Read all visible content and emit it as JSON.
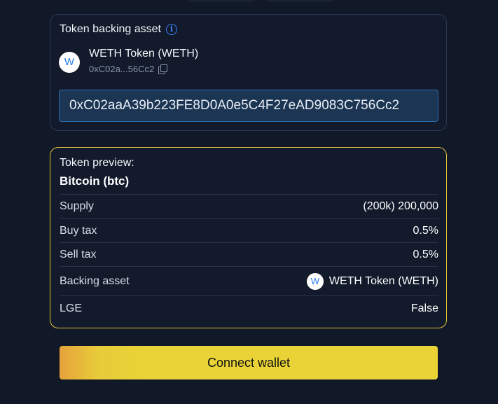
{
  "asset_card": {
    "title": "Token backing asset",
    "info_icon": "info-icon",
    "token": {
      "logo_letter": "W",
      "name": "WETH Token (WETH)",
      "short_address": "0xC02a...56Cc2",
      "copy_icon": "copy-icon"
    },
    "address_input": {
      "value": "0xC02aaA39b223FE8D0A0e5C4F27eAD9083C756Cc2"
    }
  },
  "preview": {
    "label": "Token preview:",
    "name": "Bitcoin (btc)",
    "rows": [
      {
        "label": "Supply",
        "value": "(200k) 200,000"
      },
      {
        "label": "Buy tax",
        "value": "0.5%"
      },
      {
        "label": "Sell tax",
        "value": "0.5%"
      },
      {
        "label": "Backing asset",
        "value": "WETH Token (WETH)",
        "logo_letter": "W"
      },
      {
        "label": "LGE",
        "value": "False"
      }
    ]
  },
  "connect_button": {
    "label": "Connect wallet"
  },
  "colors": {
    "background": "#111827",
    "card": "#121a2b",
    "preview_border": "#e3c43a",
    "input_bg": "#1b3553",
    "button_yellow": "#e9d336",
    "button_orange": "#e6a23c",
    "info_blue": "#3b82f6"
  }
}
